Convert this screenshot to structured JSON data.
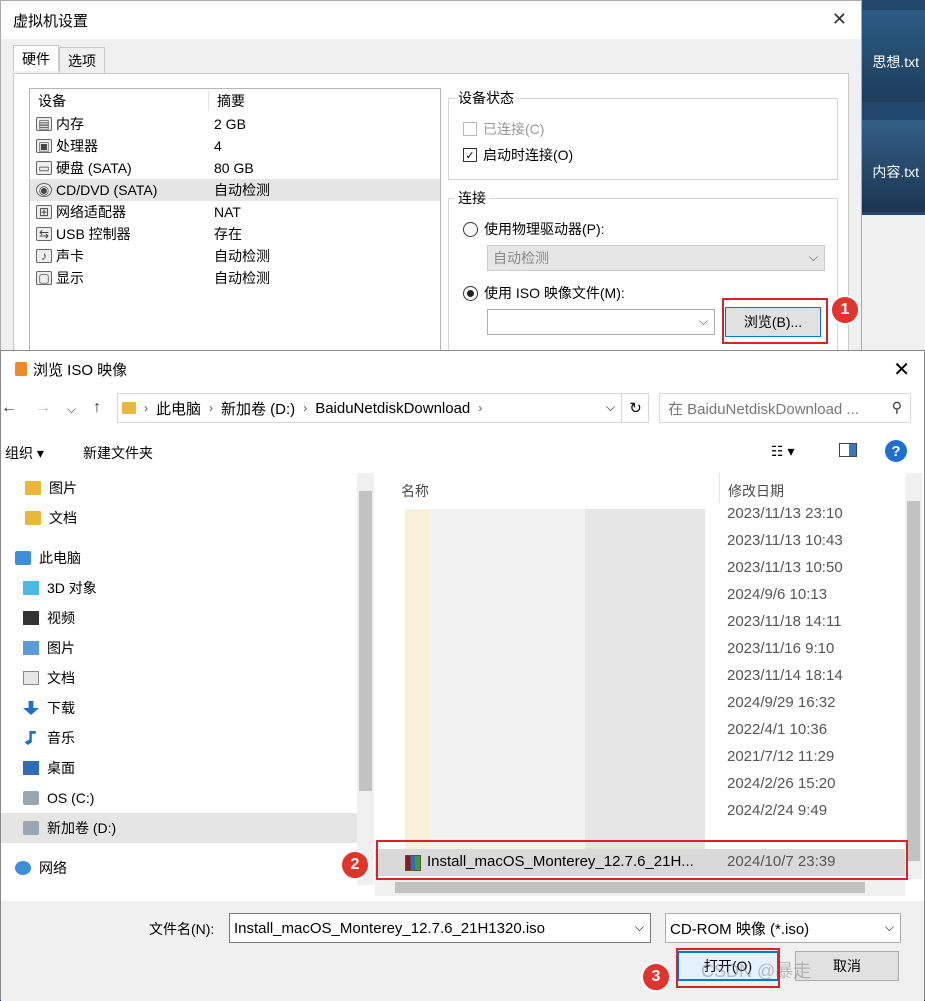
{
  "desktop": {
    "file1_label": "思想.txt",
    "file2_label": "内容.txt"
  },
  "vm_settings": {
    "title": "虚拟机设置",
    "tabs": [
      "硬件",
      "选项"
    ],
    "device_header": "设备",
    "summary_header": "摘要",
    "devices": [
      {
        "name": "内存",
        "summary": "2 GB",
        "icon": "memory-icon"
      },
      {
        "name": "处理器",
        "summary": "4",
        "icon": "cpu-icon"
      },
      {
        "name": "硬盘 (SATA)",
        "summary": "80 GB",
        "icon": "harddisk-icon"
      },
      {
        "name": "CD/DVD (SATA)",
        "summary": "自动检测",
        "icon": "cdrom-icon"
      },
      {
        "name": "网络适配器",
        "summary": "NAT",
        "icon": "network-adapter-icon"
      },
      {
        "name": "USB 控制器",
        "summary": "存在",
        "icon": "usb-icon"
      },
      {
        "name": "声卡",
        "summary": "自动检测",
        "icon": "sound-icon"
      },
      {
        "name": "显示",
        "summary": "自动检测",
        "icon": "display-icon"
      }
    ],
    "device_status_title": "设备状态",
    "connected_label": "已连接(C)",
    "connect_on_start_label": "启动时连接(O)",
    "connection_title": "连接",
    "physical_drive_label": "使用物理驱动器(P):",
    "physical_drive_value": "自动检测",
    "iso_label": "使用 ISO 映像文件(M):",
    "iso_value": "",
    "browse_label": "浏览(B)...",
    "step1": "1"
  },
  "browse_iso": {
    "title": "浏览 ISO 映像",
    "breadcrumb": [
      "此电脑",
      "新加卷 (D:)",
      "BaiduNetdiskDownload"
    ],
    "search_placeholder": "在 BaiduNetdiskDownload ...",
    "organize_label": "组织 ▾",
    "new_folder_label": "新建文件夹",
    "nav_items": [
      {
        "label": "图片",
        "icon": "folder-icon"
      },
      {
        "label": "文档",
        "icon": "folder-icon"
      },
      {
        "label": "此电脑",
        "icon": "this-pc-icon"
      },
      {
        "label": "3D 对象",
        "icon": "3d-objects-icon"
      },
      {
        "label": "视频",
        "icon": "videos-icon"
      },
      {
        "label": "图片",
        "icon": "pictures-icon"
      },
      {
        "label": "文档",
        "icon": "documents-icon"
      },
      {
        "label": "下载",
        "icon": "downloads-icon"
      },
      {
        "label": "音乐",
        "icon": "music-icon"
      },
      {
        "label": "桌面",
        "icon": "desktop-icon"
      },
      {
        "label": "OS (C:)",
        "icon": "drive-c-icon"
      },
      {
        "label": "新加卷 (D:)",
        "icon": "drive-d-icon"
      },
      {
        "label": "网络",
        "icon": "network-icon"
      }
    ],
    "col_name": "名称",
    "col_date": "修改日期",
    "files": [
      {
        "date": "2023/11/13 23:10"
      },
      {
        "date": "2023/11/13 10:43"
      },
      {
        "date": "2023/11/13 10:50"
      },
      {
        "date": "2024/9/6 10:13"
      },
      {
        "date": "2023/11/18 14:11"
      },
      {
        "date": "2023/11/16 9:10"
      },
      {
        "date": "2023/11/14 18:14"
      },
      {
        "date": "2024/9/29 16:32"
      },
      {
        "date": "2022/4/1 10:36"
      },
      {
        "date": "2021/7/12 11:29"
      },
      {
        "date": "2024/2/26 15:20"
      },
      {
        "date": "2024/2/24 9:49"
      }
    ],
    "selected_file": {
      "name": "Install_macOS_Monterey_12.7.6_21H...",
      "date": "2024/10/7 23:39"
    },
    "filename_label": "文件名(N):",
    "filename_value": "Install_macOS_Monterey_12.7.6_21H1320.iso",
    "filetype_value": "CD-ROM 映像 (*.iso)",
    "open_label": "打开(O)",
    "cancel_label": "取消",
    "watermark": "CSDN @暴走",
    "step2": "2",
    "step3": "3"
  }
}
